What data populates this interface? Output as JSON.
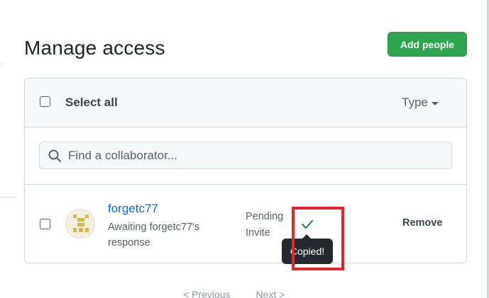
{
  "page": {
    "title": "Manage access",
    "add_button_label": "Add people"
  },
  "list_header": {
    "select_all_label": "Select all",
    "type_filter_label": "Type"
  },
  "search": {
    "placeholder": "Find a collaborator..."
  },
  "collaborators": [
    {
      "username": "forgetc77",
      "status": "Awaiting forgetc77's response",
      "invite_state": "Pending Invite",
      "remove_label": "Remove"
    }
  ],
  "tooltip": {
    "text": "Copied!"
  },
  "pagination": {
    "previous_label": "< Previous",
    "next_label": "Next >"
  },
  "colors": {
    "primary_button": "#2da44e",
    "link": "#0969da",
    "success_check": "#1a7f37",
    "highlight_box": "#e3242b",
    "tooltip_bg": "#24292f"
  },
  "icons": {
    "search": "search-icon",
    "check": "check-icon",
    "dropdown": "caret-down-icon"
  }
}
